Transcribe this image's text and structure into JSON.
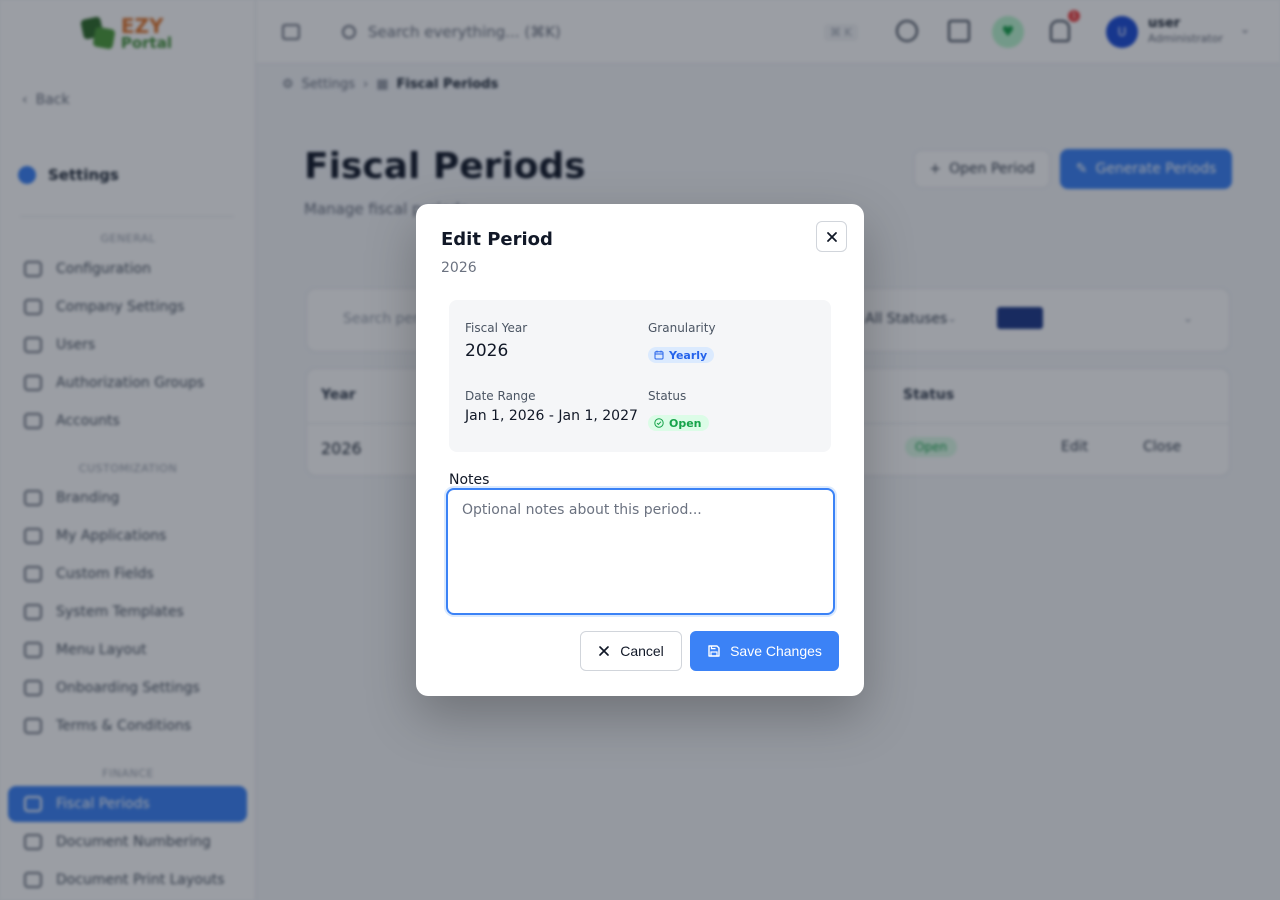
{
  "app": {
    "logo": {
      "line1": "EZY",
      "line2": "Portal"
    },
    "back_label": "Back",
    "settings_title": "Settings",
    "sections": {
      "general": "GENERAL",
      "customization": "CUSTOMIZATION",
      "finance": "FINANCE"
    },
    "sidebar": {
      "general": [
        "Configuration",
        "Company Settings",
        "Users",
        "Authorization Groups",
        "Accounts"
      ],
      "customization": [
        "Branding",
        "My Applications",
        "Custom Fields",
        "System Templates",
        "Menu Layout",
        "Onboarding Settings",
        "Terms & Conditions"
      ],
      "finance": [
        "Fiscal Periods",
        "Document Numbering",
        "Document Print Layouts"
      ]
    },
    "topbar": {
      "search_placeholder": "Search everything... (⌘K)",
      "shortcut": "⌘ K",
      "notification_count": "1",
      "user_initial": "U",
      "user_name": "user",
      "user_role": "Administrator"
    },
    "breadcrumb": {
      "parent": "Settings",
      "current": "Fiscal Periods"
    },
    "page": {
      "title": "Fiscal Periods",
      "subtitle": "Manage fiscal periods",
      "open_period_label": "Open Period",
      "generate_periods_label": "Generate Periods"
    },
    "filters": {
      "search_placeholder": "Search periods...",
      "status_label": "All Statuses"
    },
    "table": {
      "columns": {
        "year": "Year",
        "status": "Status"
      },
      "rows": [
        {
          "year": "2026",
          "status": "Open",
          "edit": "Edit",
          "close": "Close"
        }
      ]
    }
  },
  "modal": {
    "title": "Edit Period",
    "subtitle": "2026",
    "close_icon": "x-icon",
    "fiscal_year_label": "Fiscal Year",
    "fiscal_year_value": "2026",
    "granularity_label": "Granularity",
    "granularity_value": "Yearly",
    "date_range_label": "Date Range",
    "date_range_value": "Jan 1, 2026 - Jan 1, 2027",
    "status_label": "Status",
    "status_value": "Open",
    "notes_label": "Notes",
    "notes_value": "",
    "notes_placeholder": "Optional notes about this period...",
    "cancel_label": "Cancel",
    "save_label": "Save Changes"
  },
  "colors": {
    "primary": "#3b82f6",
    "success": "#16a34a",
    "info": "#2563eb"
  }
}
